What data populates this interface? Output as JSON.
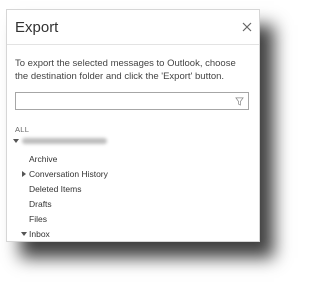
{
  "dialog": {
    "title": "Export",
    "instructions": "To export the selected messages to Outlook, choose the destination folder and click the 'Export' button.",
    "filter": {
      "value": "",
      "placeholder": ""
    },
    "all_label": "ALL",
    "tree": [
      {
        "label": "Archive"
      },
      {
        "label": "Conversation History"
      },
      {
        "label": "Deleted Items"
      },
      {
        "label": "Drafts"
      },
      {
        "label": "Files"
      },
      {
        "label": "Inbox"
      }
    ]
  },
  "colors": {
    "shadow": "#000000",
    "text": "#333333",
    "border": "#a6a6a6"
  },
  "icons": [
    "close-icon",
    "filter-icon",
    "caret-right-icon",
    "caret-down-icon"
  ]
}
